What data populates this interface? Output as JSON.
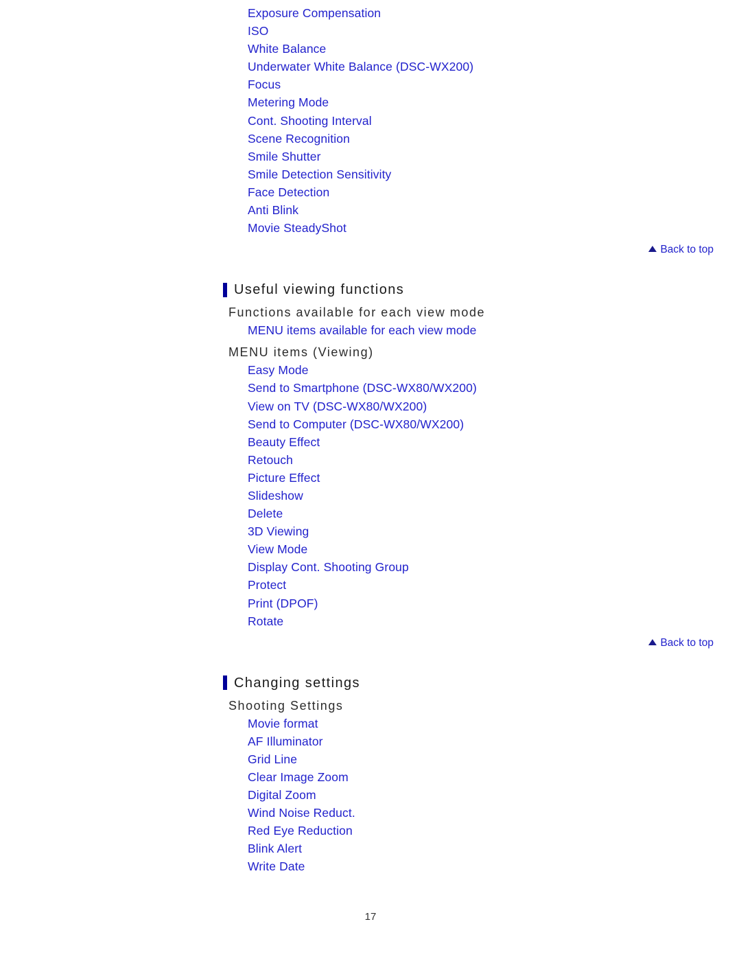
{
  "page": {
    "number": "17",
    "background": "#ffffff",
    "link_color": "#2222cc",
    "heading_color": "#1a1a1a",
    "accent_bar_color": "#000099"
  },
  "back_to_top": {
    "label": "Back to top",
    "icon": "triangle-up-icon"
  },
  "blocks": {
    "shooting_menu_list": {
      "items": [
        "Exposure Compensation",
        "ISO",
        "White Balance",
        "Underwater White Balance (DSC-WX200)",
        "Focus",
        "Metering Mode",
        "Cont. Shooting Interval",
        "Scene Recognition",
        "Smile Shutter",
        "Smile Detection Sensitivity",
        "Face Detection",
        "Anti Blink",
        "Movie SteadyShot"
      ]
    },
    "useful_viewing": {
      "heading": "Useful viewing functions",
      "subheading_1": "Functions available for each view mode",
      "sub_link_1": "MENU items available for each view mode",
      "subheading_2": "MENU items (Viewing)",
      "items": [
        "Easy Mode",
        "Send to Smartphone (DSC-WX80/WX200)",
        "View on TV (DSC-WX80/WX200)",
        "Send to Computer (DSC-WX80/WX200)",
        "Beauty Effect",
        "Retouch",
        "Picture Effect",
        "Slideshow",
        "Delete",
        "3D Viewing",
        "View Mode",
        "Display Cont. Shooting Group",
        "Protect",
        "Print (DPOF)",
        "Rotate"
      ]
    },
    "changing_settings": {
      "heading": "Changing settings",
      "subheading_1": "Shooting Settings",
      "items": [
        "Movie format",
        "AF Illuminator",
        "Grid Line",
        "Clear Image Zoom",
        "Digital Zoom",
        "Wind Noise Reduct.",
        "Red Eye Reduction",
        "Blink Alert",
        "Write Date"
      ]
    }
  }
}
